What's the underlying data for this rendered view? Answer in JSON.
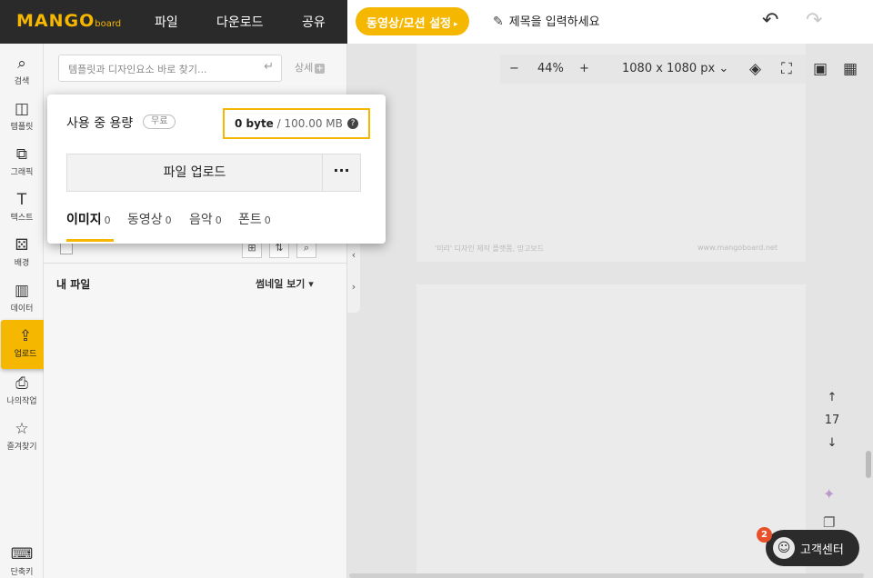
{
  "logo": {
    "main": "MANGO",
    "sub": "board"
  },
  "topmenu": {
    "file": "파일",
    "download": "다운로드",
    "share": "공유"
  },
  "video_button": {
    "label": "동영상/모션 설정",
    "arrow": "▸"
  },
  "title_input": {
    "placeholder": "제목을 입력하세요",
    "icon": "pencil-icon"
  },
  "icons": {
    "undo": "↶",
    "redo": "↷"
  },
  "sidebar": {
    "items": [
      {
        "label": "검색",
        "icon": "🔍"
      },
      {
        "label": "템플릿",
        "icon": "◫"
      },
      {
        "label": "그래픽",
        "icon": "⧉"
      },
      {
        "label": "텍스트",
        "icon": "T"
      },
      {
        "label": "배경",
        "icon": "⚄"
      },
      {
        "label": "데이터",
        "icon": "📊"
      },
      {
        "label": "업로드",
        "icon": "⇪"
      },
      {
        "label": "나의작업",
        "icon": "🖶"
      },
      {
        "label": "즐겨찾기",
        "icon": "☆"
      },
      {
        "label": "단축키",
        "icon": "⌨"
      }
    ],
    "active": "업로드"
  },
  "panel": {
    "search_placeholder": "템플릿과 디자인요소 바로 찾기...",
    "enter_icon": "↵",
    "detail_label": "상세",
    "detail_plus": "+",
    "my_file": "내 파일",
    "thumb_view": "썸네일 보기 ▾"
  },
  "popup": {
    "usage_label": "사용 중 용량",
    "free_badge": "무료",
    "used": "0 byte",
    "sep": " / ",
    "total": "100.00 MB",
    "help_icon": "?",
    "upload_button": "파일 업로드",
    "more": "···",
    "tabs": [
      {
        "label": "이미지",
        "count": "0"
      },
      {
        "label": "동영상",
        "count": "0"
      },
      {
        "label": "음악",
        "count": "0"
      },
      {
        "label": "폰트",
        "count": "0"
      }
    ]
  },
  "canvas": {
    "zoom_minus": "−",
    "zoom": "44%",
    "zoom_plus": "+",
    "size": "1080 x 1080 px",
    "size_caret": "⌄",
    "watermark_left": "'미리' 디자인 제작 플랫폼, 망고보드",
    "watermark_right": "www.mangoboard.net",
    "page_up": "↑",
    "page_number": "17",
    "page_down": "↓"
  },
  "collapse": {
    "left": "‹",
    "right": "›"
  },
  "help": {
    "label": "고객센터",
    "badge": "2",
    "face": "☺"
  },
  "colors": {
    "accent": "#f5b700",
    "topbar_dark": "#2a2a2a",
    "badge": "#e8502a"
  }
}
